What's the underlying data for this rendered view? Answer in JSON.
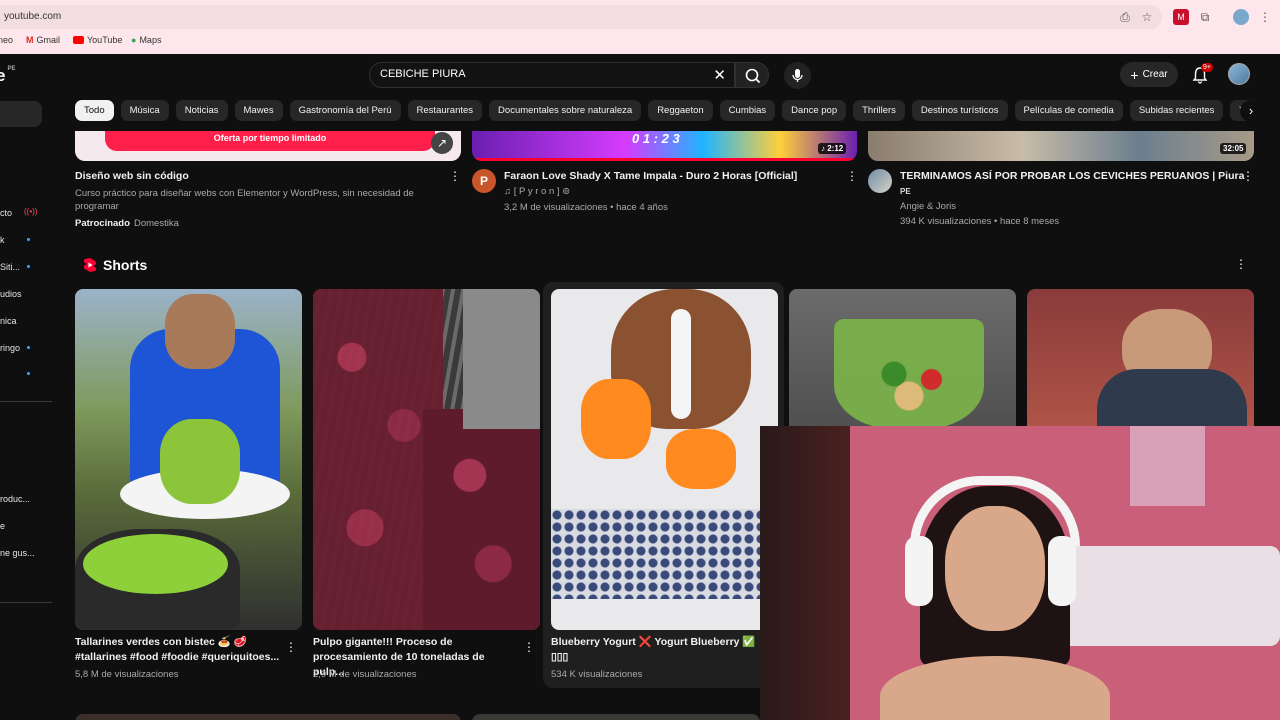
{
  "browser": {
    "url": "youtube.com",
    "bookmarks": [
      "neo",
      "Gmail",
      "YouTube",
      "Maps"
    ]
  },
  "header": {
    "logo": "e",
    "region": "PE",
    "search_value": "CEBICHE PIURA",
    "create_label": "Crear",
    "notif_count": "9+"
  },
  "chips": [
    "Todo",
    "Música",
    "Noticias",
    "Mawes",
    "Gastronomía del Perú",
    "Restaurantes",
    "Documentales sobre naturaleza",
    "Reggaeton",
    "Cumbias",
    "Dance pop",
    "Thrillers",
    "Destinos turísticos",
    "Películas de comedia",
    "Subidas recientes",
    "Vis"
  ],
  "sidebar": {
    "items": [
      "cto",
      "k",
      "Siti...",
      "udios",
      "nica",
      "ringo",
      "roduc...",
      "e",
      "ne gus..."
    ]
  },
  "videos": [
    {
      "banner": "Oferta por tiempo limitado",
      "title": "Diseño web sin código",
      "desc": "Curso práctico para diseñar webs con Elementor y WordPress, sin necesidad de programar",
      "sponsored": "Patrocinado",
      "channel": "Domestika"
    },
    {
      "title": "Faraon Love Shady X Tame Impala - Duro 2 Horas [Official]",
      "channel": "♫ [ P y r o n ] ⊚",
      "stats": "3,2 M de visualizaciones • hace 4 años",
      "duration": "2:12",
      "overlay": "0 1 : 2 3"
    },
    {
      "title": "TERMINAMOS ASÍ POR PROBAR LOS CEVICHES PERUANOS | Piura",
      "country": "PE",
      "channel": "Angie & Joris",
      "stats": "394 K visualizaciones • hace 8 meses",
      "duration": "32:05"
    }
  ],
  "shorts": {
    "heading": "Shorts",
    "items": [
      {
        "title": "Tallarines verdes con bistec 🍝 🥩 #tallarines #food #foodie #queriquitoes...",
        "views": "5,8 M de visualizaciones"
      },
      {
        "title": "Pulpo gigante!!! Proceso de procesamiento de 10 toneladas de pulp...",
        "views": "2,9 M de visualizaciones"
      },
      {
        "title": "Blueberry Yogurt ❌ Yogurt Blueberry ✅ ▯▯▯",
        "views": "534 K visualizaciones"
      },
      {
        "title": "",
        "views": ""
      },
      {
        "title": "",
        "views": ""
      }
    ]
  },
  "colors": {
    "bg": "#0f0f0f",
    "chip": "#272727",
    "accent_red": "#ff0033",
    "chrome": "#fde7ec"
  }
}
